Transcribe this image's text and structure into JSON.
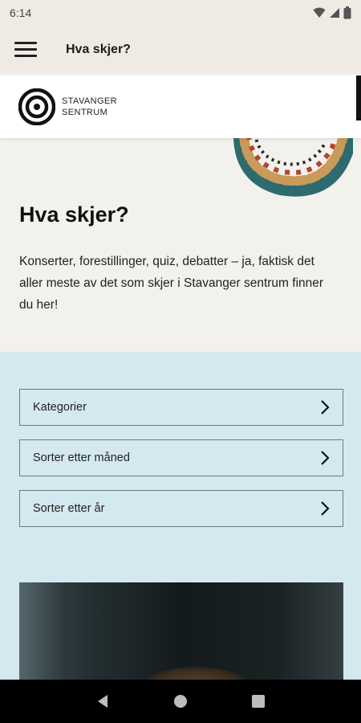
{
  "status_bar": {
    "time": "6:14"
  },
  "app_bar": {
    "title": "Hva skjer?"
  },
  "site_header": {
    "logo_line1": "STAVANGER",
    "logo_line2": "SENTRUM"
  },
  "hero": {
    "title": "Hva skjer?",
    "description": "Konserter, forestillinger, quiz, debatter – ja, faktisk det aller meste av det som skjer i Stavanger sentrum finner du her!"
  },
  "filters": [
    {
      "label": "Kategorier",
      "icon": "chevron-right-icon"
    },
    {
      "label": "Sorter etter måned",
      "icon": "chevron-right-icon"
    },
    {
      "label": "Sorter etter år",
      "icon": "chevron-right-icon"
    }
  ],
  "colors": {
    "background": "#f3f1ec",
    "app_bar": "#efebe4",
    "filter_section": "#d4e8f0",
    "nav_bar": "#000000"
  },
  "nav_icons": [
    "back-icon",
    "home-icon",
    "recents-icon"
  ]
}
